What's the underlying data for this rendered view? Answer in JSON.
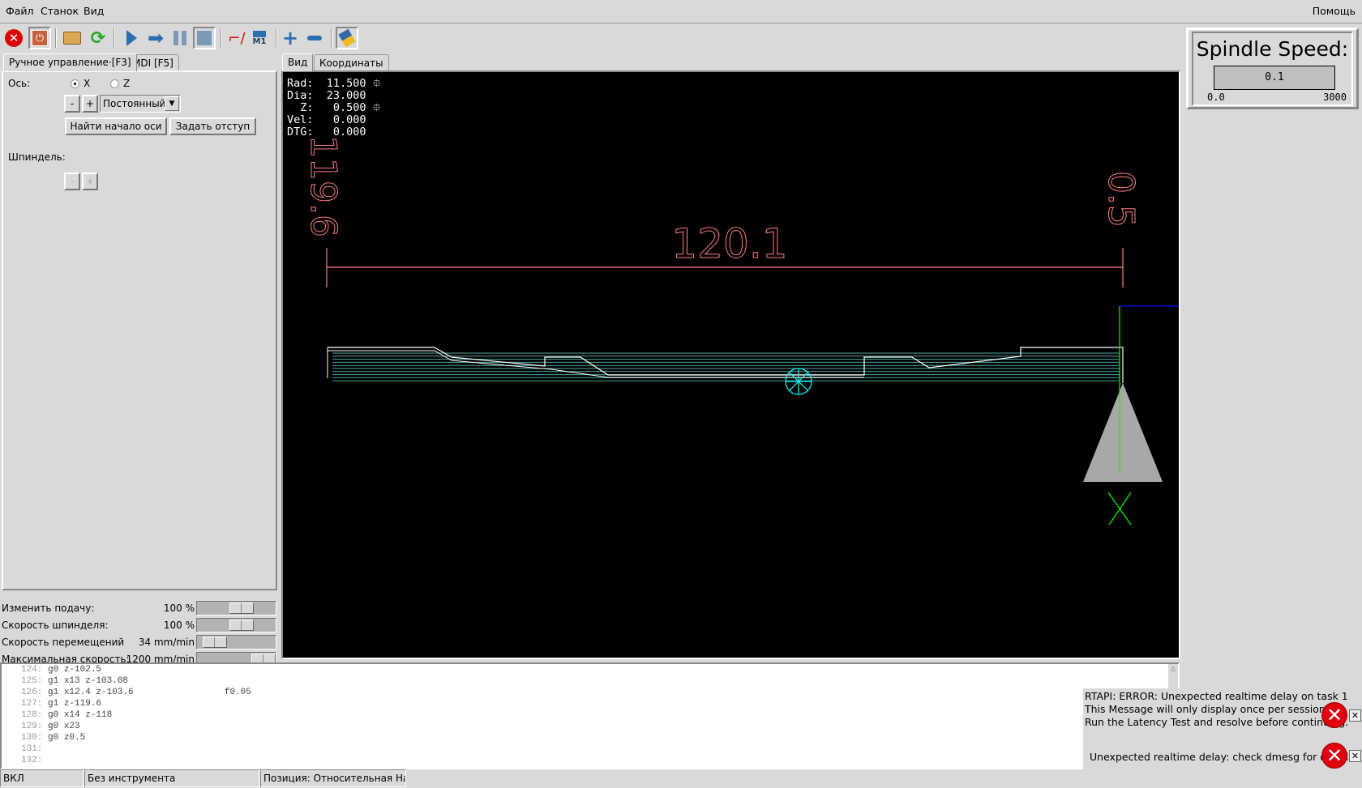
{
  "menu": {
    "file": "Файл",
    "machine": "Станок",
    "view": "Вид",
    "help": "Помощь"
  },
  "toolbar": [
    {
      "name": "estop-button",
      "icon": "estop-icon"
    },
    {
      "name": "power-button",
      "icon": "power-icon"
    },
    {
      "name": "open-file-button",
      "icon": "folder-icon"
    },
    {
      "name": "reload-button",
      "icon": "reload-icon"
    },
    {
      "name": "run-button",
      "icon": "play-icon"
    },
    {
      "name": "step-button",
      "icon": "step-arrow-icon"
    },
    {
      "name": "pause-button",
      "icon": "pause-icon"
    },
    {
      "name": "stop-button",
      "icon": "stop-icon"
    },
    {
      "name": "block-delete-button",
      "icon": "block-delete-icon"
    },
    {
      "name": "optional-stop-button",
      "icon": "m1-icon"
    },
    {
      "name": "zoom-in-button",
      "icon": "plus-icon"
    },
    {
      "name": "zoom-out-button",
      "icon": "minus-icon"
    },
    {
      "name": "clear-plot-button",
      "icon": "brush-icon"
    }
  ],
  "left_tabs": {
    "manual": "Ручное управление·[F3]",
    "mdi": "MDI [F5]"
  },
  "manual": {
    "axis_label": "Ось:",
    "axis_x": "X",
    "axis_z": "Z",
    "selected_axis": "X",
    "minus": "-",
    "plus": "+",
    "jog_mode": "Постоянный",
    "home_button": "Найти начало оси",
    "touch_off_button": "Задать отступ",
    "spindle_label": "Шпиндель:"
  },
  "overrides": [
    {
      "label": "Изменить подачу:",
      "value": "100 %",
      "fraction": 0.6
    },
    {
      "label": "Скорость шпинделя:",
      "value": "100 %",
      "fraction": 0.6
    },
    {
      "label": "Скорость перемещений",
      "value": "34 mm/min",
      "fraction": 0.1
    },
    {
      "label": "Максимальная скорость:",
      "value": "1200 mm/min",
      "fraction": 1.0
    }
  ],
  "view_tabs": {
    "view": "Вид",
    "coords": "Координаты"
  },
  "dro": [
    {
      "label": "Rad:",
      "value": "11.500",
      "homed": true
    },
    {
      "label": "Dia:",
      "value": "23.000",
      "homed": false
    },
    {
      "label": "  Z:",
      "value": " 0.500",
      "homed": true
    },
    {
      "label": "Vel:",
      "value": " 0.000",
      "homed": false
    },
    {
      "label": "DTG:",
      "value": " 0.000",
      "homed": false
    }
  ],
  "dimensions": {
    "length": "120.1",
    "left": "119.6",
    "right": "0.5"
  },
  "colors": {
    "dimension": "#ff7f7f",
    "feed": "#ffffff",
    "traverse": "#4fa6a6",
    "origin": "#00ffff",
    "x_axis": "#00ff00",
    "z_axis": "#0000ff"
  },
  "code": [
    {
      "n": "124:",
      "text": "g0 z-102.5"
    },
    {
      "n": "125:",
      "text": "g1 x13 z-103.08"
    },
    {
      "n": "126:",
      "text": "g1 x12.4 z-103.6                 f0.05"
    },
    {
      "n": "127:",
      "text": "g1 z-119.6"
    },
    {
      "n": "128:",
      "text": "g0 x14 z-118"
    },
    {
      "n": "129:",
      "text": "g0 x23"
    },
    {
      "n": "130:",
      "text": "g0 z0.5"
    },
    {
      "n": "131:",
      "text": ""
    },
    {
      "n": "132:",
      "text": ""
    }
  ],
  "status": {
    "state": "ВКЛ",
    "tool": "Без инструмента",
    "position": "Позиция: Относительная Наст"
  },
  "spindle": {
    "title": "Spindle Speed:",
    "value": "0.1",
    "min": "0.0",
    "max": "3000"
  },
  "errors": [
    {
      "lines": [
        "RTAPI: ERROR: Unexpected realtime delay on task 1",
        "This Message will only display once per session.",
        "Run the Latency Test and resolve before continuing."
      ]
    },
    {
      "lines": [
        "Unexpected realtime delay: check dmesg for details."
      ]
    }
  ]
}
